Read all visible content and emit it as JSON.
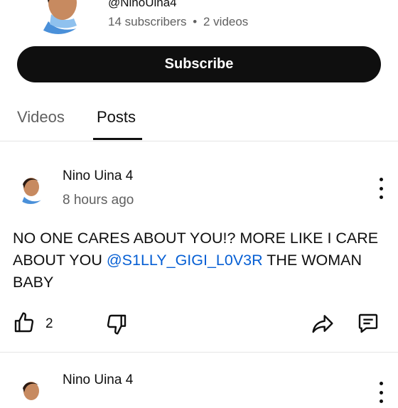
{
  "channel": {
    "handle": "@NinoUina4",
    "subscribers": "14 subscribers",
    "separator": "•",
    "videos": "2 videos",
    "subscribe_label": "Subscribe"
  },
  "tabs": [
    {
      "label": "Videos",
      "selected": false
    },
    {
      "label": "Posts",
      "selected": true
    }
  ],
  "posts": [
    {
      "author": "Nino Uina 4",
      "time": "8 hours ago",
      "text_before": "NO ONE CARES ABOUT YOU!? MORE LIKE I CARE ABOUT YOU ",
      "mention": "@S1LLY_GIGI_L0V3R",
      "text_after": " THE WOMAN BABY",
      "likes": "2"
    },
    {
      "author": "Nino Uina 4"
    }
  ],
  "colors": {
    "mention": "#065fd4",
    "subscribe_bg": "#0f0f0f",
    "secondary_text": "#606060"
  }
}
